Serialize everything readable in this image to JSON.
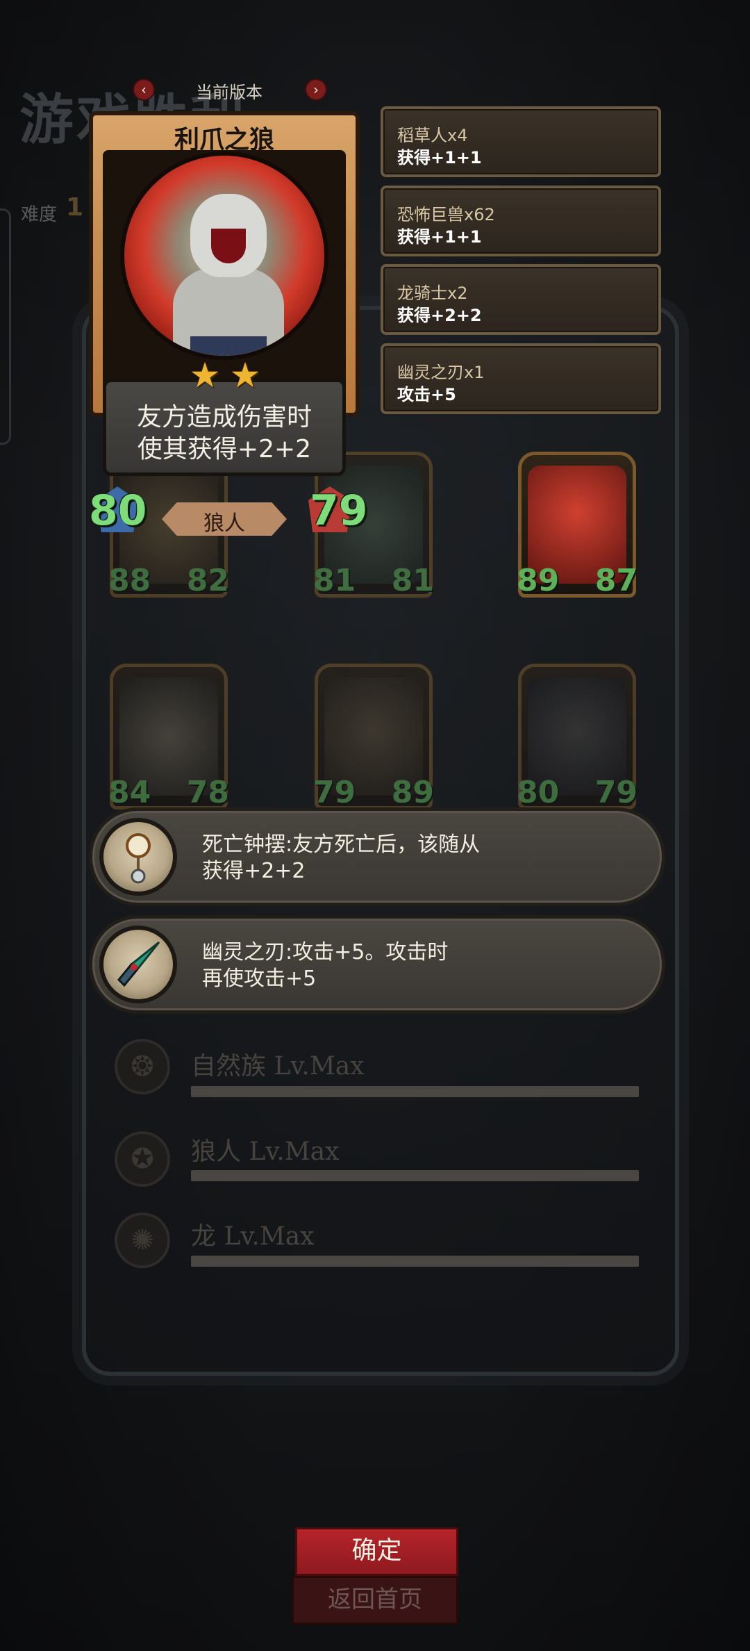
{
  "background": {
    "title": "游戏胜利",
    "difficulty_label": "难度",
    "difficulty_value": "1"
  },
  "version": {
    "label": "当前版本",
    "prev": "‹",
    "next": "›"
  },
  "featured_card": {
    "name": "利爪之狼",
    "stars": 2,
    "description_line1": "友方造成伤害时",
    "description_line2": "使其获得+2+2",
    "attack": "80",
    "health": "79",
    "tribe": "狼人"
  },
  "effects": [
    {
      "title": "稻草人x4",
      "value": "获得+1+1"
    },
    {
      "title": "恐怖巨兽x62",
      "value": "获得+1+1"
    },
    {
      "title": "龙骑士x2",
      "value": "获得+2+2"
    },
    {
      "title": "幽灵之刃x1",
      "value": "攻击+5"
    }
  ],
  "minions": [
    {
      "attack": "88",
      "health": "82"
    },
    {
      "attack": "81",
      "health": "81"
    },
    {
      "attack": "89",
      "health": "87"
    },
    {
      "attack": "84",
      "health": "78"
    },
    {
      "attack": "79",
      "health": "89"
    },
    {
      "attack": "80",
      "health": "79"
    }
  ],
  "relics": [
    {
      "line1": "死亡钟摆:友方死亡后，该随从",
      "line2": "获得+2+2",
      "icon": "pendulum-icon"
    },
    {
      "line1": "幽灵之刃:攻击+5。攻击时",
      "line2": "再使攻击+5",
      "icon": "ghost-blade-icon"
    }
  ],
  "tribes": [
    {
      "name": "自然族 Lv.Max",
      "icon": "nature-tribe-icon"
    },
    {
      "name": "狼人 Lv.Max",
      "icon": "werewolf-tribe-icon"
    },
    {
      "name": "龙 Lv.Max",
      "icon": "dragon-tribe-icon"
    }
  ],
  "buttons": {
    "confirm": "确定",
    "home": "返回首页"
  },
  "colors": {
    "accent_red": "#b5242a",
    "stat_green": "#7fdc7a",
    "star_gold": "#f0b530"
  }
}
